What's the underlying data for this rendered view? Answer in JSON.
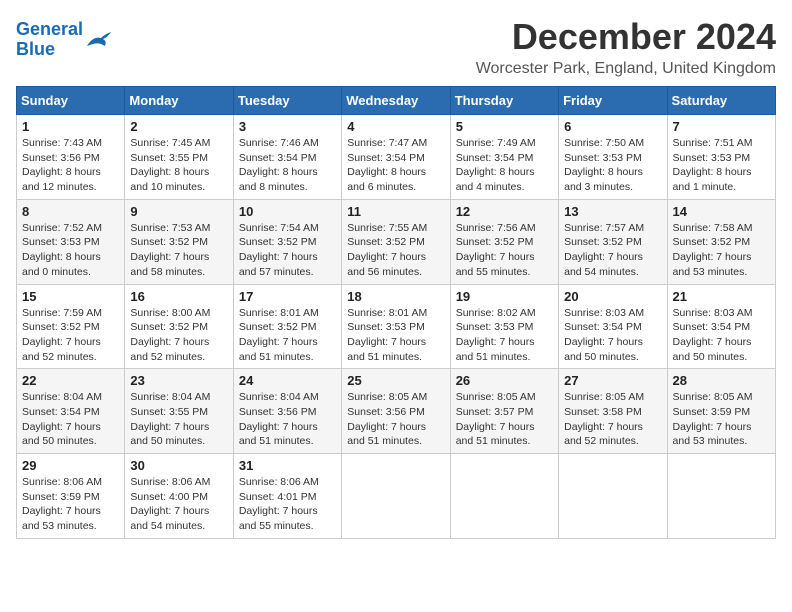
{
  "logo": {
    "text_general": "General",
    "text_blue": "Blue"
  },
  "header": {
    "month": "December 2024",
    "location": "Worcester Park, England, United Kingdom"
  },
  "weekdays": [
    "Sunday",
    "Monday",
    "Tuesday",
    "Wednesday",
    "Thursday",
    "Friday",
    "Saturday"
  ],
  "weeks": [
    [
      {
        "day": "1",
        "sunrise": "7:43 AM",
        "sunset": "3:56 PM",
        "daylight": "8 hours and 12 minutes."
      },
      {
        "day": "2",
        "sunrise": "7:45 AM",
        "sunset": "3:55 PM",
        "daylight": "8 hours and 10 minutes."
      },
      {
        "day": "3",
        "sunrise": "7:46 AM",
        "sunset": "3:54 PM",
        "daylight": "8 hours and 8 minutes."
      },
      {
        "day": "4",
        "sunrise": "7:47 AM",
        "sunset": "3:54 PM",
        "daylight": "8 hours and 6 minutes."
      },
      {
        "day": "5",
        "sunrise": "7:49 AM",
        "sunset": "3:54 PM",
        "daylight": "8 hours and 4 minutes."
      },
      {
        "day": "6",
        "sunrise": "7:50 AM",
        "sunset": "3:53 PM",
        "daylight": "8 hours and 3 minutes."
      },
      {
        "day": "7",
        "sunrise": "7:51 AM",
        "sunset": "3:53 PM",
        "daylight": "8 hours and 1 minute."
      }
    ],
    [
      {
        "day": "8",
        "sunrise": "7:52 AM",
        "sunset": "3:53 PM",
        "daylight": "8 hours and 0 minutes."
      },
      {
        "day": "9",
        "sunrise": "7:53 AM",
        "sunset": "3:52 PM",
        "daylight": "7 hours and 58 minutes."
      },
      {
        "day": "10",
        "sunrise": "7:54 AM",
        "sunset": "3:52 PM",
        "daylight": "7 hours and 57 minutes."
      },
      {
        "day": "11",
        "sunrise": "7:55 AM",
        "sunset": "3:52 PM",
        "daylight": "7 hours and 56 minutes."
      },
      {
        "day": "12",
        "sunrise": "7:56 AM",
        "sunset": "3:52 PM",
        "daylight": "7 hours and 55 minutes."
      },
      {
        "day": "13",
        "sunrise": "7:57 AM",
        "sunset": "3:52 PM",
        "daylight": "7 hours and 54 minutes."
      },
      {
        "day": "14",
        "sunrise": "7:58 AM",
        "sunset": "3:52 PM",
        "daylight": "7 hours and 53 minutes."
      }
    ],
    [
      {
        "day": "15",
        "sunrise": "7:59 AM",
        "sunset": "3:52 PM",
        "daylight": "7 hours and 52 minutes."
      },
      {
        "day": "16",
        "sunrise": "8:00 AM",
        "sunset": "3:52 PM",
        "daylight": "7 hours and 52 minutes."
      },
      {
        "day": "17",
        "sunrise": "8:01 AM",
        "sunset": "3:52 PM",
        "daylight": "7 hours and 51 minutes."
      },
      {
        "day": "18",
        "sunrise": "8:01 AM",
        "sunset": "3:53 PM",
        "daylight": "7 hours and 51 minutes."
      },
      {
        "day": "19",
        "sunrise": "8:02 AM",
        "sunset": "3:53 PM",
        "daylight": "7 hours and 51 minutes."
      },
      {
        "day": "20",
        "sunrise": "8:03 AM",
        "sunset": "3:54 PM",
        "daylight": "7 hours and 50 minutes."
      },
      {
        "day": "21",
        "sunrise": "8:03 AM",
        "sunset": "3:54 PM",
        "daylight": "7 hours and 50 minutes."
      }
    ],
    [
      {
        "day": "22",
        "sunrise": "8:04 AM",
        "sunset": "3:54 PM",
        "daylight": "7 hours and 50 minutes."
      },
      {
        "day": "23",
        "sunrise": "8:04 AM",
        "sunset": "3:55 PM",
        "daylight": "7 hours and 50 minutes."
      },
      {
        "day": "24",
        "sunrise": "8:04 AM",
        "sunset": "3:56 PM",
        "daylight": "7 hours and 51 minutes."
      },
      {
        "day": "25",
        "sunrise": "8:05 AM",
        "sunset": "3:56 PM",
        "daylight": "7 hours and 51 minutes."
      },
      {
        "day": "26",
        "sunrise": "8:05 AM",
        "sunset": "3:57 PM",
        "daylight": "7 hours and 51 minutes."
      },
      {
        "day": "27",
        "sunrise": "8:05 AM",
        "sunset": "3:58 PM",
        "daylight": "7 hours and 52 minutes."
      },
      {
        "day": "28",
        "sunrise": "8:05 AM",
        "sunset": "3:59 PM",
        "daylight": "7 hours and 53 minutes."
      }
    ],
    [
      {
        "day": "29",
        "sunrise": "8:06 AM",
        "sunset": "3:59 PM",
        "daylight": "7 hours and 53 minutes."
      },
      {
        "day": "30",
        "sunrise": "8:06 AM",
        "sunset": "4:00 PM",
        "daylight": "7 hours and 54 minutes."
      },
      {
        "day": "31",
        "sunrise": "8:06 AM",
        "sunset": "4:01 PM",
        "daylight": "7 hours and 55 minutes."
      },
      null,
      null,
      null,
      null
    ]
  ],
  "labels": {
    "sunrise": "Sunrise:",
    "sunset": "Sunset:",
    "daylight": "Daylight:"
  }
}
